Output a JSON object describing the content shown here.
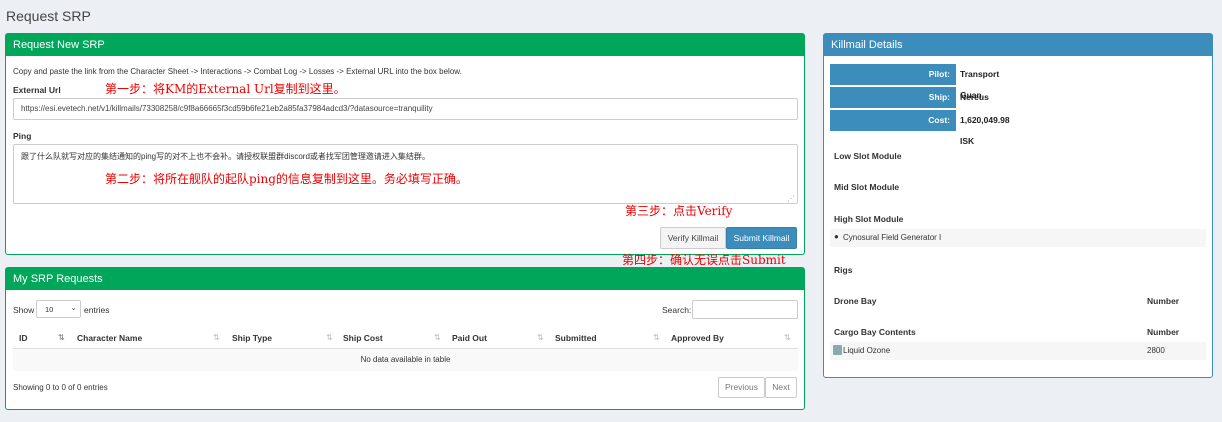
{
  "page": {
    "title": "Request SRP"
  },
  "request_panel": {
    "title": "Request New SRP",
    "instructions": "Copy and paste the link from the Character Sheet -> Interactions -> Combat Log -> Losses -> External URL into the box below.",
    "external_url_label": "External Url",
    "external_url_value": "https://esi.evetech.net/v1/killmails/73308258/c9f8a66665f3cd59b6fe21eb2a85fa37984adcd3/?datasource=tranquility",
    "ping_label": "Ping",
    "ping_value": "跟了什么队就写对应的集结通知的ping写的对不上也不会补。请授权联盟群discord或者找军团管理邀请进入集结群。",
    "verify_label": "Verify Killmail",
    "submit_label": "Submit Killmail"
  },
  "annotations": {
    "step1": "第一步：将KM的External Url复制到这里。",
    "step2": "第二步：将所在舰队的起队ping的信息复制到这里。务必填写正确。",
    "step3": "第三步：点击Verify",
    "step4": "第四步：确认无误点击Submit"
  },
  "srp_panel": {
    "title": "My SRP Requests",
    "show_label": "Show",
    "entries_value": "10",
    "entries_label": "entries",
    "search_label": "Search:",
    "columns": [
      "ID",
      "Character Name",
      "Ship Type",
      "Ship Cost",
      "Paid Out",
      "Submitted",
      "Approved By"
    ],
    "empty_text": "No data available in table",
    "info_text": "Showing 0 to 0 of 0 entries",
    "previous_label": "Previous",
    "next_label": "Next"
  },
  "killmail_panel": {
    "title": "Killmail Details",
    "pilot_key": "Pilot:",
    "pilot_value": "Transport Guan",
    "ship_key": "Ship:",
    "ship_value": "Nereus",
    "cost_key": "Cost:",
    "cost_value": "1,620,049.98 ISK",
    "low_slot_label": "Low Slot Module",
    "mid_slot_label": "Mid Slot Module",
    "high_slot_label": "High Slot Module",
    "high_slot_item": "Cynosural Field Generator I",
    "rigs_label": "Rigs",
    "drone_bay_label": "Drone Bay",
    "drone_number_label": "Number",
    "cargo_label": "Cargo Bay Contents",
    "cargo_number_label": "Number",
    "cargo_item": "Liquid Ozone",
    "cargo_item_qty": "2800"
  },
  "colors": {
    "green": "#00a65a",
    "blue": "#3c8dbc",
    "annotation": "#e00000"
  }
}
